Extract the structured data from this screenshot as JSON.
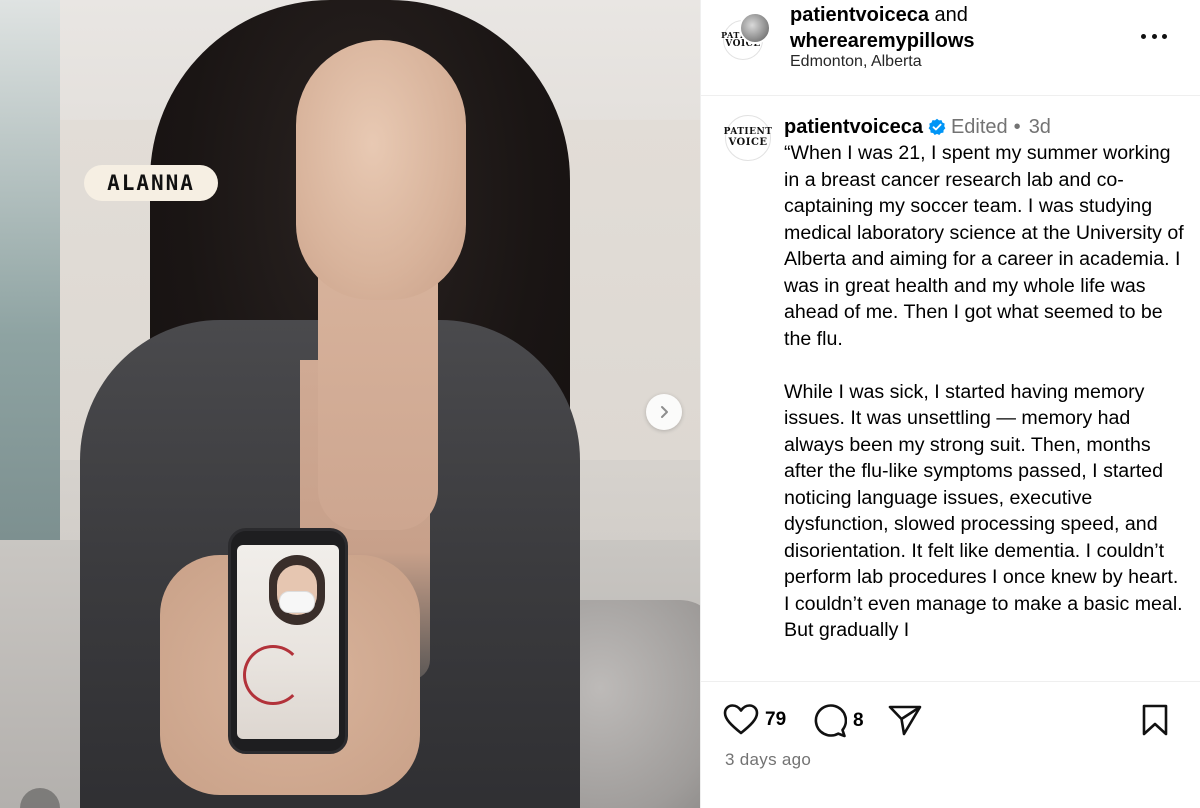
{
  "photo": {
    "name_tag": "ALANNA",
    "next_icon": "chevron-right-icon"
  },
  "header": {
    "account_primary": "patientvoiceca",
    "joiner": "and",
    "account_collab": "wherearemypillows",
    "location": "Edmonton, Alberta",
    "avatar_text_top": "PATIENT",
    "avatar_text_bottom": "VOICE",
    "more_icon": "more-horizontal-icon"
  },
  "caption": {
    "username": "patientvoiceca",
    "verified_icon": "verified-badge-icon",
    "edited": "Edited",
    "separator": "•",
    "time": "3d",
    "avatar_text_top": "PATIENT",
    "avatar_text_bottom": "VOICE",
    "paragraphs": [
      "“When I was 21, I spent my summer working in a breast cancer research lab and co-captaining my soccer team. I was studying medical laboratory science at the University of Alberta and aiming for a career in academia. I was in great health and my whole life was ahead of me. Then I got what seemed to be the flu.",
      "While I was sick, I started having memory issues. It was unsettling — memory had always been my strong suit. Then, months after the flu-like symptoms passed, I started noticing language issues, executive dysfunction, slowed processing speed, and disorientation. It felt like dementia. I couldn’t perform lab procedures I once knew by heart. I couldn’t even manage to make a basic meal. But gradually I"
    ]
  },
  "actions": {
    "like_count": "79",
    "comment_count": "8",
    "like_icon": "heart-icon",
    "comment_icon": "comment-icon",
    "share_icon": "share-send-icon",
    "save_icon": "bookmark-icon",
    "timestamp": "3 days ago"
  },
  "colors": {
    "verified": "#0095f6",
    "secondary_text": "#737373",
    "divider": "#efefef",
    "name_tag_bg": "#f6efe3"
  }
}
